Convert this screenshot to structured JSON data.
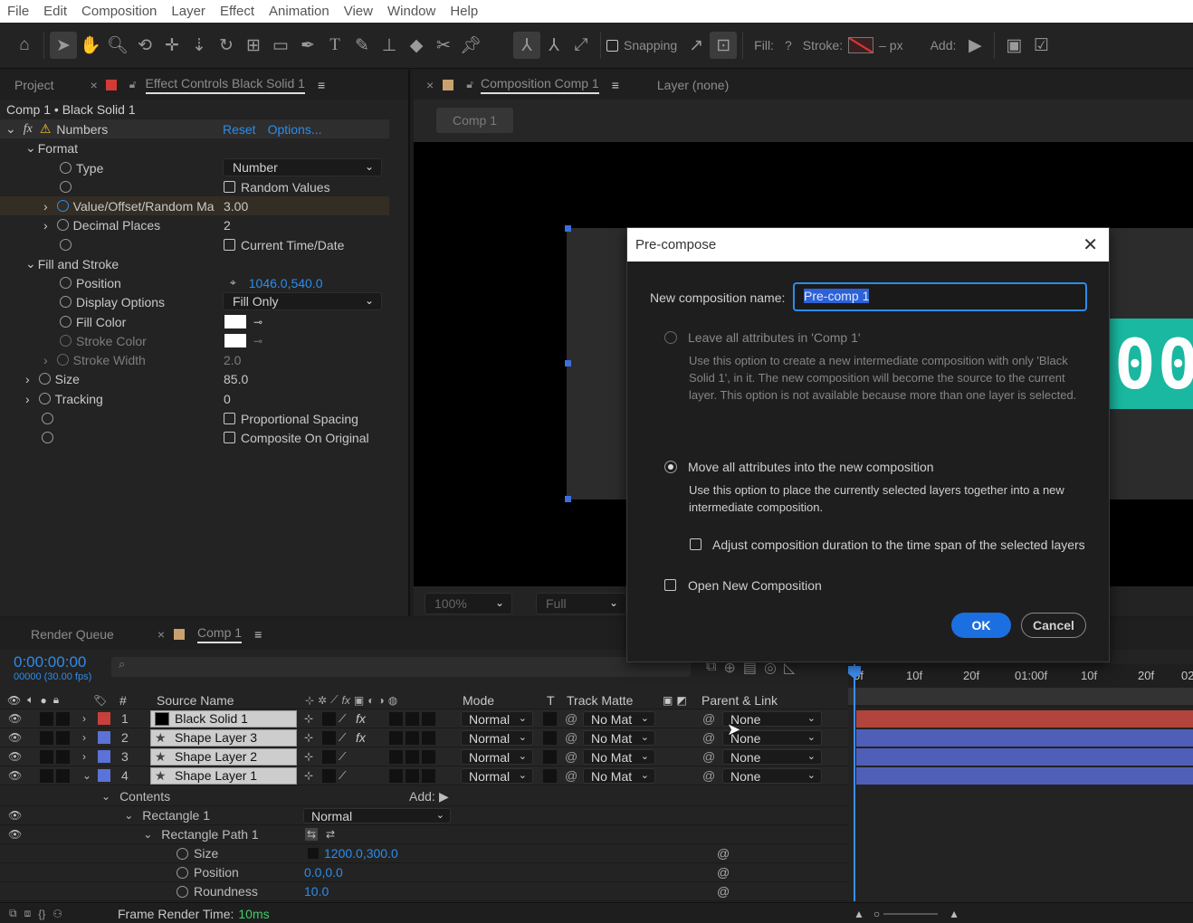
{
  "menu": [
    "File",
    "Edit",
    "Composition",
    "Layer",
    "Effect",
    "Animation",
    "View",
    "Window",
    "Help"
  ],
  "toolbar": {
    "snapping": "Snapping",
    "fill": "Fill:",
    "fill_q": "?",
    "stroke": "Stroke:",
    "stroke_unit": "– px",
    "add": "Add:"
  },
  "left_panel": {
    "tab_project": "Project",
    "tab_effect": "Effect Controls Black Solid 1",
    "breadcrumb": "Comp 1 • Black Solid 1",
    "effect_name": "Numbers",
    "reset": "Reset",
    "options": "Options...",
    "format": "Format",
    "type": "Type",
    "type_value": "Number",
    "random_values": "Random Values",
    "value_offset": "Value/Offset/Random Ma",
    "value_offset_val": "3.00",
    "decimal": "Decimal Places",
    "decimal_val": "2",
    "current_time": "Current Time/Date",
    "fill_stroke": "Fill and Stroke",
    "position": "Position",
    "position_val": "1046.0,540.0",
    "display_options": "Display Options",
    "display_val": "Fill Only",
    "fill_color": "Fill Color",
    "stroke_color": "Stroke Color",
    "stroke_width": "Stroke Width",
    "stroke_width_val": "2.0",
    "size": "Size",
    "size_val": "85.0",
    "tracking": "Tracking",
    "tracking_val": "0",
    "prop_spacing": "Proportional Spacing",
    "composite": "Composite On Original"
  },
  "comp_panel": {
    "tab": "Composition Comp 1",
    "layer_tab": "Layer (none)",
    "comp_btn": "Comp 1",
    "zoom": "100%",
    "res": "Full",
    "digits": "00"
  },
  "dialog": {
    "title": "Pre-compose",
    "name_label": "New composition name:",
    "name_value": "Pre-comp 1",
    "opt1": "Leave all attributes in 'Comp 1'",
    "opt1_desc": "Use this option to create a new intermediate composition with only 'Black Solid 1', in it. The new composition will become the source to the current layer. This option is not available because more than one layer is selected.",
    "opt2": "Move all attributes into the new composition",
    "opt2_desc": "Use this option to place the currently selected layers together into a new intermediate composition.",
    "adjust": "Adjust composition duration to the time span of the selected layers",
    "open_new": "Open New Composition",
    "ok": "OK",
    "cancel": "Cancel"
  },
  "timeline": {
    "tab_render": "Render Queue",
    "tab_comp": "Comp 1",
    "timecode": "0:00:00:00",
    "frames": "00000 (30.00 fps)",
    "headers": {
      "num": "#",
      "source": "Source Name",
      "mode": "Mode",
      "t": "T",
      "track": "Track Matte",
      "parent": "Parent & Link"
    },
    "ruler": [
      "0f",
      "10f",
      "20f",
      "01:00f",
      "10f",
      "20f",
      "02"
    ],
    "layers": [
      {
        "num": "1",
        "name": "Black Solid 1",
        "color": "#c7413a",
        "mode": "Normal",
        "matte": "No Mat",
        "parent": "None",
        "fx": true,
        "bar": "#b1443c"
      },
      {
        "num": "2",
        "name": "Shape Layer 3",
        "color": "#5b72d6",
        "mode": "Normal",
        "matte": "No Mat",
        "parent": "None",
        "fx": true,
        "bar": "#4f5fb8"
      },
      {
        "num": "3",
        "name": "Shape Layer 2",
        "color": "#5b72d6",
        "mode": "Normal",
        "matte": "No Mat",
        "parent": "None",
        "fx": false,
        "bar": "#4f5fb8"
      },
      {
        "num": "4",
        "name": "Shape Layer 1",
        "color": "#5b72d6",
        "mode": "Normal",
        "matte": "No Mat",
        "parent": "None",
        "fx": false,
        "bar": "#4f5fb8"
      }
    ],
    "contents": "Contents",
    "add": "Add:",
    "rect1": "Rectangle 1",
    "rect1_mode": "Normal",
    "rectpath": "Rectangle Path 1",
    "size": "Size",
    "size_val": "1200.0,300.0",
    "position": "Position",
    "position_val": "0.0,0.0",
    "roundness": "Roundness",
    "roundness_val": "10.0",
    "frame_render": "Frame Render Time:",
    "frame_render_val": "10ms"
  },
  "colors": {
    "accent": "#2d8ceb",
    "teal": "#1ab8a0",
    "ok": "#1c6fe0"
  }
}
